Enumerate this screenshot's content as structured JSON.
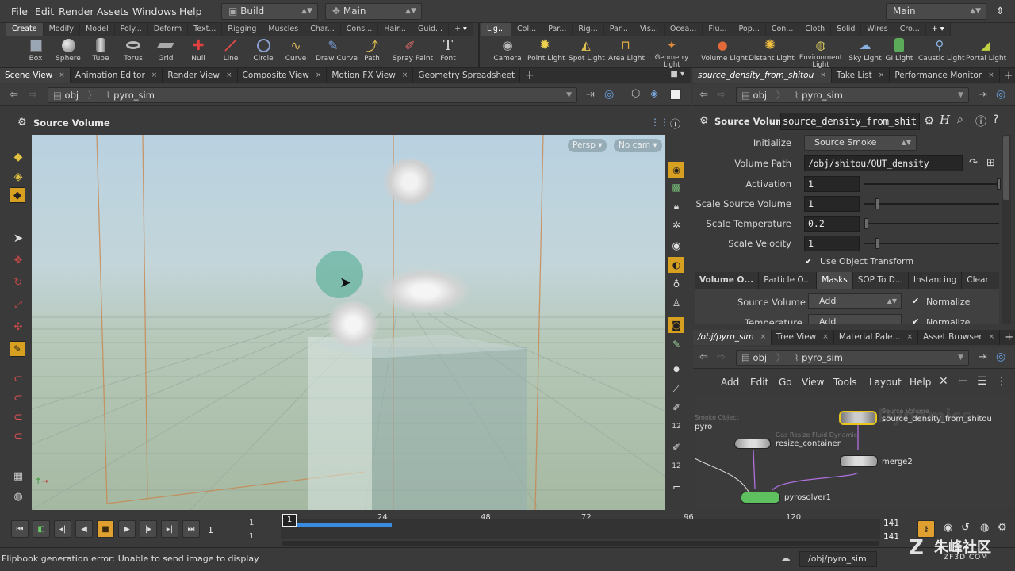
{
  "menu": [
    "File",
    "Edit",
    "Render",
    "Assets",
    "Windows",
    "Help"
  ],
  "desktop_build": "Build",
  "desktop_main": "Main",
  "desktop_right": "Main",
  "shelf_tabs_left": [
    "Create",
    "Modify",
    "Model",
    "Poly...",
    "Deform",
    "Text...",
    "Rigging",
    "Muscles",
    "Char...",
    "Cons...",
    "Hair...",
    "Guid..."
  ],
  "shelf_tabs_right": [
    "Lig...",
    "Col...",
    "Par...",
    "Rig...",
    "Par...",
    "Vis...",
    "Ocea...",
    "Flu...",
    "Pop...",
    "Con...",
    "Cloth",
    "Solid",
    "Wires",
    "Cro..."
  ],
  "tools_left": [
    "Box",
    "Sphere",
    "Tube",
    "Torus",
    "Grid",
    "Null",
    "Line",
    "Circle",
    "Curve",
    "Draw Curve",
    "Path",
    "Spray Paint",
    "Font"
  ],
  "tools_right": [
    "Camera",
    "Point Light",
    "Spot Light",
    "Area Light",
    "Geometry Light",
    "Volume Light",
    "Distant Light",
    "Environment Light",
    "Sky Light",
    "GI Light",
    "Caustic Light",
    "Portal Light"
  ],
  "viewer_tabs": [
    "Scene View",
    "Animation Editor",
    "Render View",
    "Composite View",
    "Motion FX View",
    "Geometry Spreadsheet"
  ],
  "path": {
    "root": "obj",
    "node": "pyro_sim"
  },
  "viewer": {
    "title": "Source Volume",
    "persp": "Persp",
    "cam": "No cam"
  },
  "param_tabs": [
    "source_density_from_shitou",
    "Take List",
    "Performance Monitor"
  ],
  "param_header": {
    "type": "Source Volume",
    "name": "source_density_from_shit"
  },
  "params": {
    "initialize_label": "Initialize",
    "initialize_value": "Source Smoke",
    "volume_path_label": "Volume Path",
    "volume_path_value": "/obj/shitou/OUT_density",
    "activation_label": "Activation",
    "activation_value": "1",
    "scale_source_label": "Scale Source Volume",
    "scale_source_value": "1",
    "scale_temp_label": "Scale Temperature",
    "scale_temp_value": "0.2",
    "scale_vel_label": "Scale Velocity",
    "scale_vel_value": "1",
    "use_obj_xform": "Use Object Transform"
  },
  "sub_tabs": [
    "Volume O...",
    "Particle O...",
    "Masks",
    "SOP To D...",
    "Instancing",
    "Clear"
  ],
  "masks": {
    "source_volume_label": "Source Volume",
    "source_volume_value": "Add",
    "temperature_label": "Temperature",
    "temperature_value": "Add",
    "normalize": "Normalize"
  },
  "net_tabs": [
    "/obj/pyro_sim",
    "Tree View",
    "Material Pale...",
    "Asset Browser"
  ],
  "net_menu": [
    "Add",
    "Edit",
    "Go",
    "View",
    "Tools",
    "Layout",
    "Help"
  ],
  "net_watermark": "Dynamics",
  "nodes": {
    "smoke_type": "Smoke Object",
    "smoke_name": "pyro",
    "resize_type": "Gas Resize Fluid Dynamic",
    "resize_name": "resize_container",
    "source_type": "Source Volume",
    "source_name": "source_density_from_shitou",
    "merge_name": "merge2",
    "solver_name": "pyrosolver1"
  },
  "timeline": {
    "current": "1",
    "start": "1",
    "start2": "1",
    "end": "141",
    "end2": "141",
    "ticks": [
      "1",
      "24",
      "48",
      "72",
      "96",
      "120"
    ]
  },
  "status_text": "Flipbook generation error: Unable to send image to display",
  "status_path": "/obj/pyro_sim",
  "watermark": "朱峰社区",
  "watermark_url": "ZF3D.COM"
}
